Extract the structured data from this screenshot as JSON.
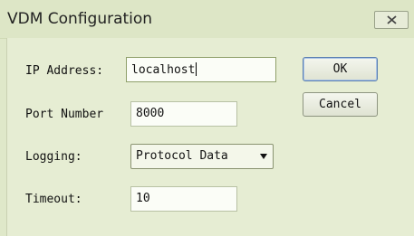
{
  "window": {
    "title": "VDM Configuration"
  },
  "form": {
    "ip_label": "IP Address:",
    "ip_value": "localhost",
    "port_label": "Port Number",
    "port_value": "8000",
    "logging_label": "Logging:",
    "logging_value": "Protocol Data",
    "timeout_label": "Timeout:",
    "timeout_value": "10"
  },
  "buttons": {
    "ok": "OK",
    "cancel": "Cancel"
  },
  "icons": {
    "close": "close-icon",
    "dropdown": "chevron-down-icon"
  }
}
